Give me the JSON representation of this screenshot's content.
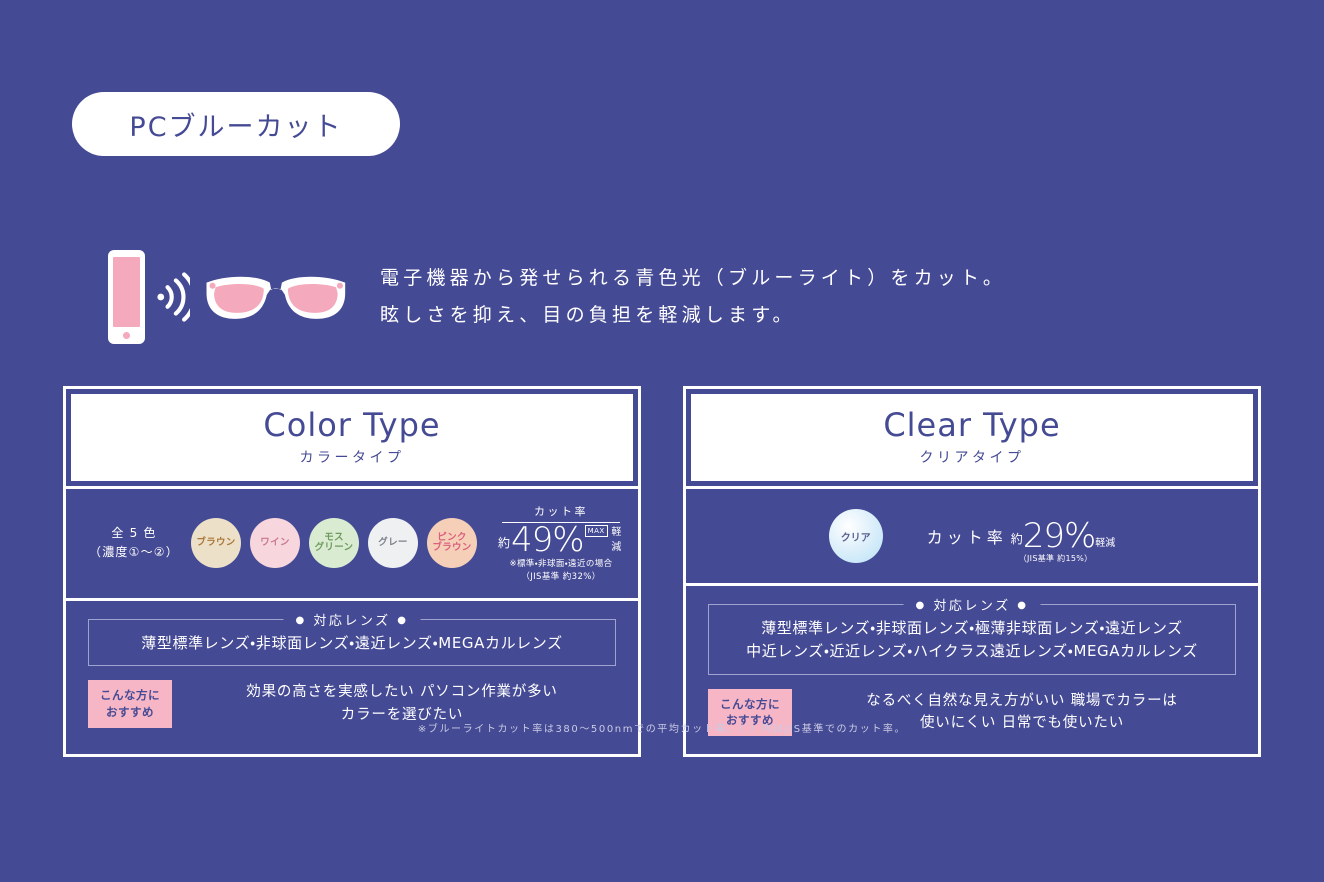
{
  "theme": {
    "background": "#454a94",
    "white": "#ffffff",
    "pink": "#f4a9bd",
    "badge_pink": "#f6b6c6",
    "lens_border": "#9ea3cf"
  },
  "title": {
    "pill_label": "PCブルーカット"
  },
  "hero": {
    "icons": [
      "smartphone-icon",
      "signal-waves-icon",
      "glasses-icon"
    ],
    "line1": "電子機器から発せられる青色光（ブルーライト）をカット。",
    "line2": "眩しさを抑え、目の負担を軽減します。"
  },
  "panels": [
    {
      "id": "color-type",
      "header_en": "Color Type",
      "header_jp": "カラータイプ",
      "count_line1": "全 5 色",
      "count_line2": "（濃度①〜②）",
      "swatches": [
        {
          "label": "ブラウン",
          "bg": "#ede0c8",
          "text_color": "#a9793c"
        },
        {
          "label": "ワイン",
          "bg": "#f7d7dd",
          "text_color": "#c9798f"
        },
        {
          "label": "モス\nグリーン",
          "bg": "#d9ecd2",
          "text_color": "#6e9a5e"
        },
        {
          "label": "グレー",
          "bg": "#eef0f2",
          "text_color": "#7c8189"
        },
        {
          "label": "ピンク\nブラウン",
          "bg": "#f6cfb8",
          "text_color": "#d9607f"
        }
      ],
      "cut": {
        "title": "カット率",
        "approx": "約",
        "value": "49%",
        "max_badge": "MAX",
        "suffix": "軽減",
        "note_line1": "※標準・非球面・遠近の場合",
        "note_line2": "（JIS基準 約32%）"
      },
      "lens_title_label": "対応レンズ",
      "lens_lines": [
        "薄型標準レンズ・非球面レンズ・遠近レンズ・MEGAカルレンズ"
      ],
      "rec_badge_line1": "こんな方に",
      "rec_badge_line2": "おすすめ",
      "rec_lines": [
        "効果の高さを実感したい パソコン作業が多い",
        "カラーを選びたい"
      ]
    },
    {
      "id": "clear-type",
      "header_en": "Clear Type",
      "header_jp": "クリアタイプ",
      "swatch": {
        "label": "クリア"
      },
      "cut": {
        "title": "カット率",
        "approx": "約",
        "value": "29%",
        "suffix": "軽減",
        "note": "（JIS基準 約15%）"
      },
      "lens_title_label": "対応レンズ",
      "lens_lines": [
        "薄型標準レンズ・非球面レンズ・極薄非球面レンズ・遠近レンズ",
        "中近レンズ・近近レンズ・ハイクラス遠近レンズ・MEGAカルレンズ"
      ],
      "rec_badge_line1": "こんな方に",
      "rec_badge_line2": "おすすめ",
      "rec_lines": [
        "なるべく自然な見え方がいい 職場でカラーは",
        "使いにくい 日常でも使いたい"
      ]
    }
  ],
  "footnote": "※ブルーライトカット率は380〜500nmでの平均カット率。（ ）内はJIS基準でのカット率。"
}
